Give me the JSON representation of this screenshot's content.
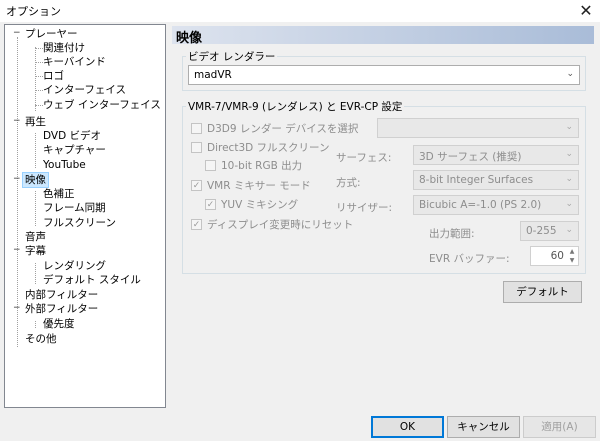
{
  "window": {
    "title": "オプション",
    "close_glyph": "✕"
  },
  "tree": {
    "items": [
      {
        "label": "プレーヤー",
        "expander": "−"
      },
      {
        "label": "関連付け"
      },
      {
        "label": "キーバインド"
      },
      {
        "label": "ロゴ"
      },
      {
        "label": "インターフェイス"
      },
      {
        "label": "ウェブ インターフェイス"
      },
      {
        "label": "再生",
        "expander": "−"
      },
      {
        "label": "DVD ビデオ"
      },
      {
        "label": "キャプチャー"
      },
      {
        "label": "YouTube"
      },
      {
        "label": "映像",
        "expander": "−",
        "selected": true
      },
      {
        "label": "色補正"
      },
      {
        "label": "フレーム同期"
      },
      {
        "label": "フルスクリーン"
      },
      {
        "label": "音声"
      },
      {
        "label": "字幕",
        "expander": "−"
      },
      {
        "label": "レンダリング"
      },
      {
        "label": "デフォルト スタイル"
      },
      {
        "label": "内部フィルター"
      },
      {
        "label": "外部フィルター",
        "expander": "−"
      },
      {
        "label": "優先度"
      },
      {
        "label": "その他"
      }
    ]
  },
  "page": {
    "header": "映像",
    "renderer_group_label": "ビデオ レンダラー",
    "renderer_value": "madVR",
    "vmr_group_label": "VMR-7/VMR-9 (レンダレス) と EVR-CP 設定",
    "d3d9_select_label": "D3D9 レンダー デバイスを選択",
    "d3d9_select_value": "",
    "direct3d_fullscreen_label": "Direct3D フルスクリーン",
    "rgb10_label": "10-bit RGB 出力",
    "vmr_mixer_label": "VMR ミキサー モード",
    "yuv_mixing_label": "YUV ミキシング",
    "reset_on_display_change_label": "ディスプレイ変更時にリセット",
    "surface_label": "サーフェス:",
    "surface_value": "3D サーフェス (推奨)",
    "method_label": "方式:",
    "method_value": "8-bit Integer Surfaces",
    "resizer_label": "リサイザー:",
    "resizer_value": "Bicubic A=-1.0 (PS 2.0)",
    "output_range_label": "出力範囲:",
    "output_range_value": "0-255",
    "evr_buffer_label": "EVR バッファー:",
    "evr_buffer_value": "60",
    "default_button": "デフォルト",
    "check_glyph": "✓",
    "combo_arrow": "⌄",
    "spin_up": "▲",
    "spin_down": "▼"
  },
  "buttons": {
    "ok": "OK",
    "cancel": "キャンセル",
    "apply": "適用(A)"
  }
}
